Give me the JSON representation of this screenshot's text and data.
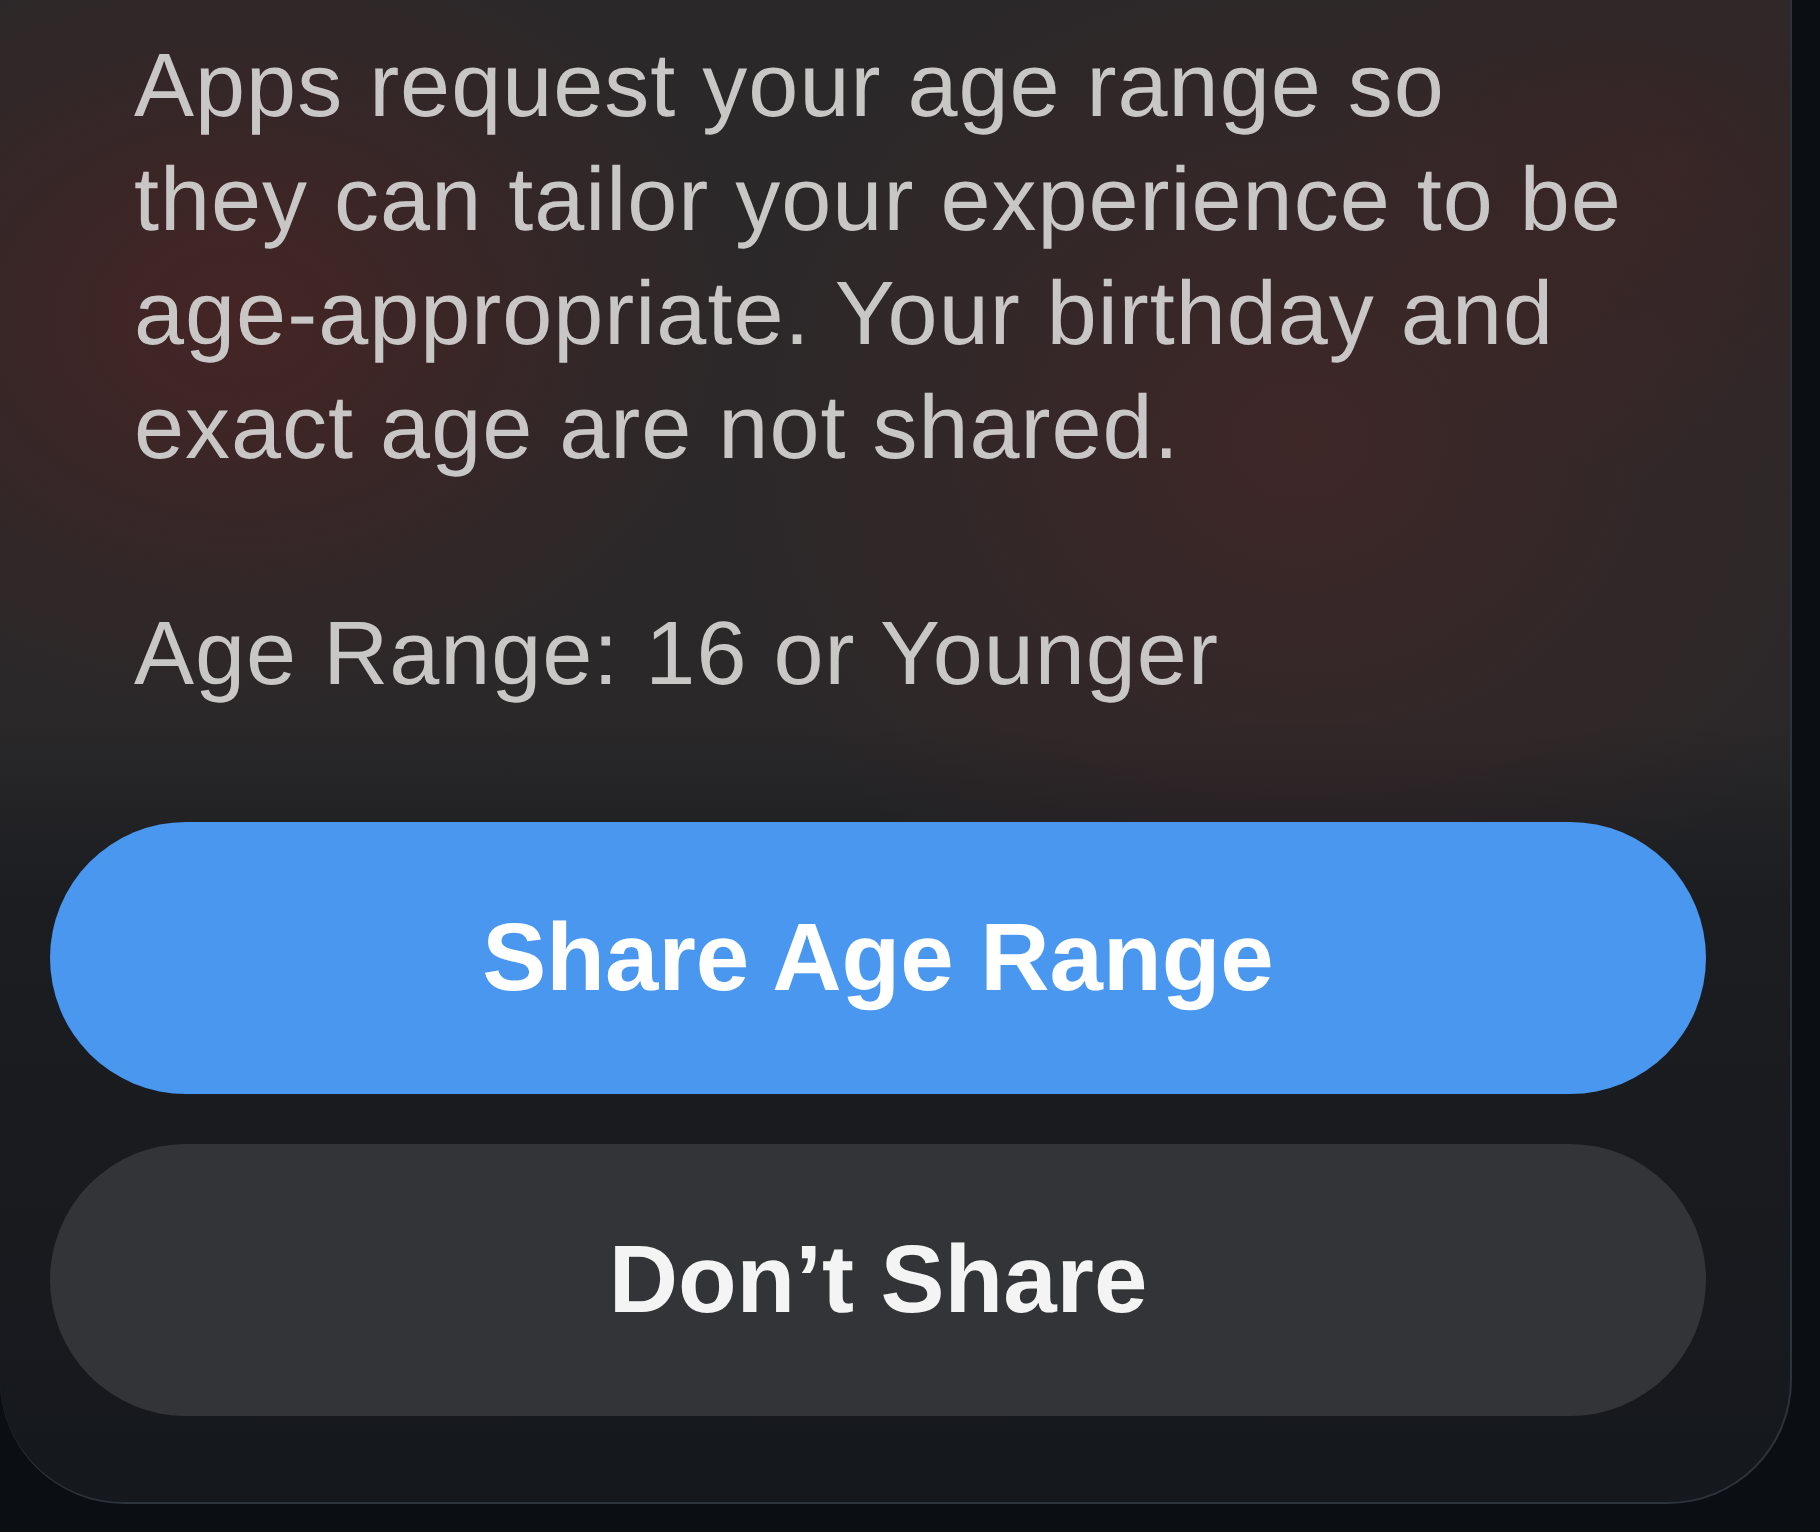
{
  "sheet": {
    "description": "Apps request your age range so they can tailor your experience to be age-appropriate. Your birthday and exact age are not shared.",
    "age_range": "Age Range: 16 or Younger"
  },
  "buttons": [
    {
      "label": "Share Age Range",
      "kind": "primary"
    },
    {
      "label": "Don’t Share",
      "kind": "secondary"
    }
  ]
}
